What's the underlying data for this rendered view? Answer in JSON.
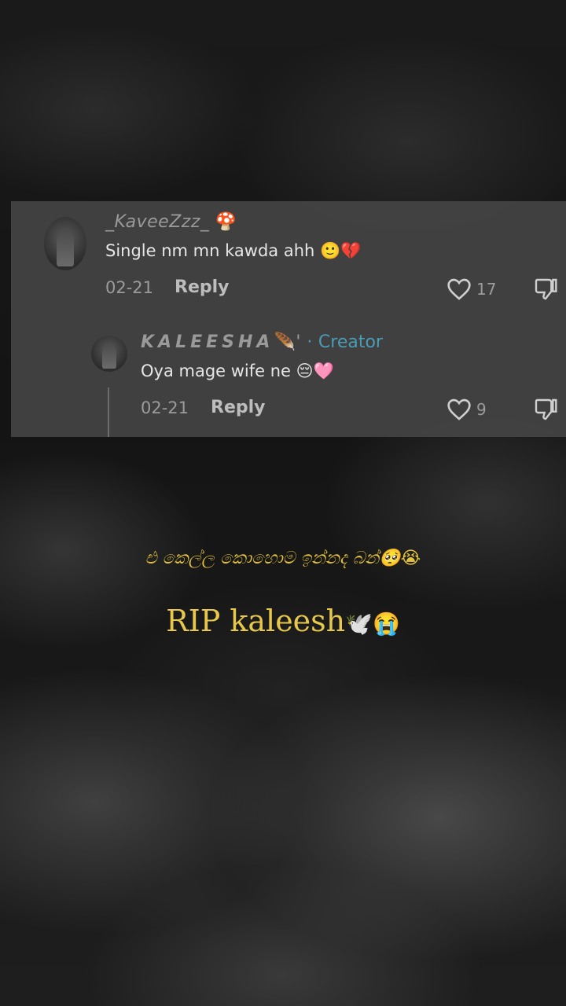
{
  "comments": [
    {
      "username": "_KaveeZzz_",
      "username_emoji": "🍄",
      "text": "Single nm mn kawda ahh 🙂💔",
      "date": "02-21",
      "reply_label": "Reply",
      "likes": "17"
    },
    {
      "username": "KALEESHA",
      "username_suffix": "🪶'",
      "separator": "·",
      "tag": "Creator",
      "text": "Oya mage wife ne 😔🩷",
      "date": "02-21",
      "reply_label": "Reply",
      "likes": "9"
    }
  ],
  "caption": {
    "sinhala": "එ කෙල්ල කොහොම ඉන්නද බන්🥺😭",
    "rip_text": "RIP kaleesh",
    "rip_emojis": "🕊️😭"
  },
  "colors": {
    "creator_tag": "#4a9bb5",
    "caption": "#e3c23a",
    "panel": "#484848"
  },
  "icons": [
    "heart-outline-icon",
    "dislike-icon"
  ]
}
